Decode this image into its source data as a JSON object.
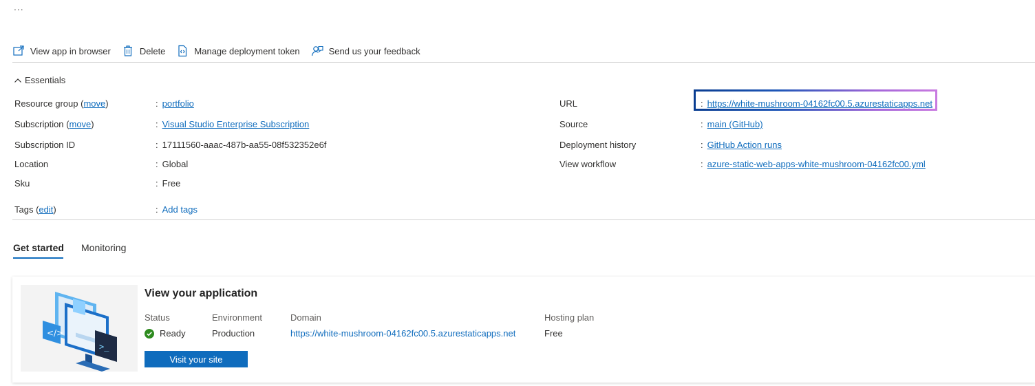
{
  "header": {
    "more_label": "..."
  },
  "toolbar": {
    "view_app": "View app in browser",
    "delete": "Delete",
    "manage_token": "Manage deployment token",
    "feedback": "Send us your feedback"
  },
  "essentials": {
    "toggle_label": "Essentials",
    "left": {
      "resource_group": {
        "label": "Resource group",
        "action": "move",
        "value": "portfolio"
      },
      "subscription": {
        "label": "Subscription",
        "action": "move",
        "value": "Visual Studio Enterprise Subscription"
      },
      "subscription_id": {
        "label": "Subscription ID",
        "value": "17111560-aaac-487b-aa55-08f532352e6f"
      },
      "location": {
        "label": "Location",
        "value": "Global"
      },
      "sku": {
        "label": "Sku",
        "value": "Free"
      },
      "tags": {
        "label": "Tags",
        "action": "edit",
        "value": "Add tags"
      }
    },
    "right": {
      "url": {
        "label": "URL",
        "value": "https://white-mushroom-04162fc00.5.azurestaticapps.net"
      },
      "source": {
        "label": "Source",
        "value": "main (GitHub)"
      },
      "deployment_history": {
        "label": "Deployment history",
        "value": "GitHub Action runs"
      },
      "view_workflow": {
        "label": "View workflow",
        "value": "azure-static-web-apps-white-mushroom-04162fc00.yml"
      }
    }
  },
  "tabs": {
    "get_started": "Get started",
    "monitoring": "Monitoring"
  },
  "card": {
    "title": "View your application",
    "status": {
      "header": "Status",
      "value": "Ready"
    },
    "environment": {
      "header": "Environment",
      "value": "Production"
    },
    "domain": {
      "header": "Domain",
      "value": "https://white-mushroom-04162fc00.5.azurestaticapps.net"
    },
    "hosting_plan": {
      "header": "Hosting plan",
      "value": "Free"
    },
    "visit_button": "Visit your site"
  },
  "colors": {
    "link": "#0f6cbd",
    "success": "#2e8b1f",
    "highlight_start": "#0a3d91",
    "highlight_end": "#c97ae0"
  }
}
